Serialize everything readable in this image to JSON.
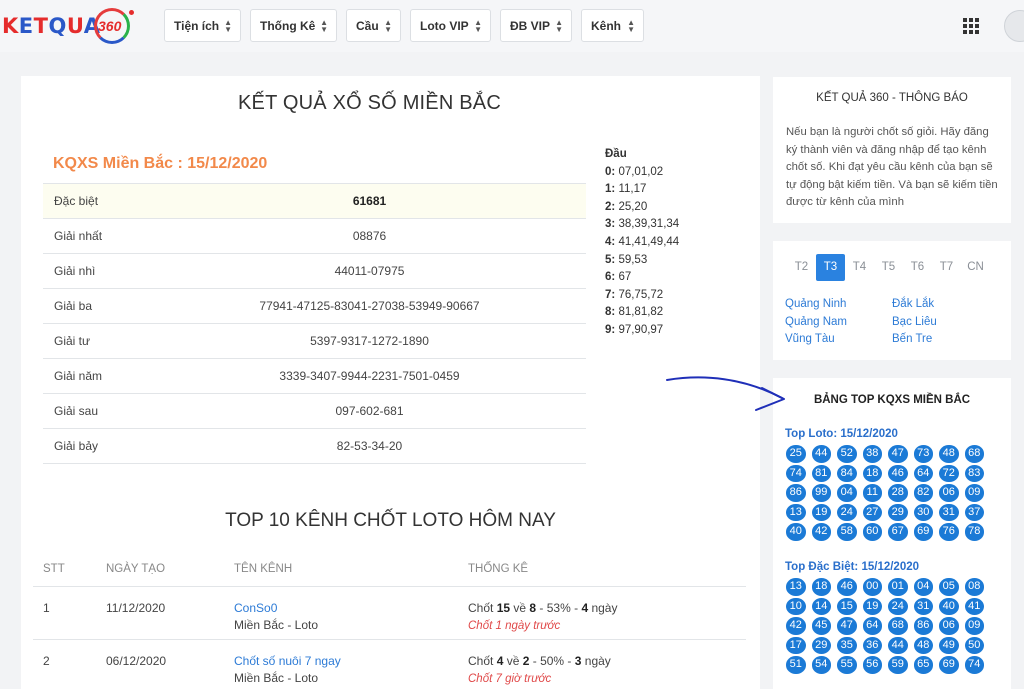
{
  "logo": {
    "text": "KETQUA",
    "suffix": "360"
  },
  "nav": [
    {
      "label": "Tiện ích"
    },
    {
      "label": "Thống Kê"
    },
    {
      "label": "Cầu"
    },
    {
      "label": "Loto VIP"
    },
    {
      "label": "ĐB VIP"
    },
    {
      "label": "Kênh"
    }
  ],
  "main": {
    "title": "KẾT QUẢ XỔ SỐ MIỀN BẮC",
    "subtitle": "KQXS Miền Bắc : 15/12/2020",
    "results": [
      {
        "label": "Đặc biệt",
        "value": "61681"
      },
      {
        "label": "Giải nhất",
        "value": "08876"
      },
      {
        "label": "Giải nhì",
        "value": "44011-07975"
      },
      {
        "label": "Giải ba",
        "value": "77941-47125-83041-27038-53949-90667"
      },
      {
        "label": "Giải tư",
        "value": "5397-9317-1272-1890"
      },
      {
        "label": "Giải năm",
        "value": "3339-3407-9944-2231-7501-0459"
      },
      {
        "label": "Giải sau",
        "value": "097-602-681"
      },
      {
        "label": "Giải bảy",
        "value": "82-53-34-20"
      }
    ],
    "dau": {
      "header": "Đầu",
      "rows": [
        {
          "k": "0:",
          "v": "07,01,02"
        },
        {
          "k": "1:",
          "v": "11,17"
        },
        {
          "k": "2:",
          "v": "25,20"
        },
        {
          "k": "3:",
          "v": "38,39,31,34"
        },
        {
          "k": "4:",
          "v": "41,41,49,44"
        },
        {
          "k": "5:",
          "v": "59,53"
        },
        {
          "k": "6:",
          "v": "67"
        },
        {
          "k": "7:",
          "v": "76,75,72"
        },
        {
          "k": "8:",
          "v": "81,81,82"
        },
        {
          "k": "9:",
          "v": "97,90,97"
        }
      ]
    },
    "top10_title": "TOP 10 KÊNH CHỐT LOTO HÔM NAY",
    "channel_headers": [
      "STT",
      "NGÀY TẠO",
      "TÊN KÊNH",
      "THỐNG KÊ"
    ],
    "channels": [
      {
        "stt": "1",
        "date": "11/12/2020",
        "name": "ConSo0",
        "region": "Miền Bắc - Loto",
        "stat_pre": "Chốt ",
        "stat_a": "15",
        "stat_mid1": " về ",
        "stat_b": "8",
        "stat_mid2": " - 53% - ",
        "stat_c": "4",
        "stat_post": " ngày",
        "ago": "Chốt 1 ngày trước"
      },
      {
        "stt": "2",
        "date": "06/12/2020",
        "name": "Chốt số nuôi 7 ngay",
        "region": "Miền Bắc - Loto",
        "stat_pre": "Chốt ",
        "stat_a": "4",
        "stat_mid1": " về ",
        "stat_b": "2",
        "stat_mid2": " - 50% - ",
        "stat_c": "3",
        "stat_post": " ngày",
        "ago": "Chốt 7 giờ trước"
      }
    ]
  },
  "notice": {
    "title": "KẾT QUẢ 360 - THÔNG BÁO",
    "body": "Nếu bạn là người chốt số giỏi. Hãy đăng ký thành viên và đăng nhập để tạo kênh chốt số. Khi đạt yêu cầu kênh của bạn sẽ tự động bật kiếm tiền. Và bạn sẽ kiếm tiền được từ kênh của mình"
  },
  "days": {
    "tabs": [
      "T2",
      "T3",
      "T4",
      "T5",
      "T6",
      "T7",
      "CN"
    ],
    "active": "T3",
    "provinces_left": [
      "Quảng Ninh",
      "Quảng Nam",
      "Vũng Tàu"
    ],
    "provinces_right": [
      "Đắk Lắk",
      "Bạc Liêu",
      "Bến Tre"
    ]
  },
  "tops": {
    "title": "BẢNG TOP KQXS MIỀN BẮC",
    "loto_label": "Top Loto: 15/12/2020",
    "loto": [
      "25",
      "44",
      "52",
      "38",
      "47",
      "73",
      "48",
      "68",
      "74",
      "81",
      "84",
      "18",
      "46",
      "64",
      "72",
      "83",
      "86",
      "99",
      "04",
      "11",
      "28",
      "82",
      "06",
      "09",
      "13",
      "19",
      "24",
      "27",
      "29",
      "30",
      "31",
      "37",
      "40",
      "42",
      "58",
      "60",
      "67",
      "69",
      "76",
      "78"
    ],
    "db_label": "Top Đặc Biệt: 15/12/2020",
    "db": [
      "13",
      "18",
      "46",
      "00",
      "01",
      "04",
      "05",
      "08",
      "10",
      "14",
      "15",
      "19",
      "24",
      "31",
      "40",
      "41",
      "42",
      "45",
      "47",
      "64",
      "68",
      "86",
      "06",
      "09",
      "17",
      "29",
      "35",
      "36",
      "44",
      "48",
      "49",
      "50",
      "51",
      "54",
      "55",
      "56",
      "59",
      "65",
      "69",
      "74"
    ]
  },
  "colors": {
    "accent": "#2a82e0",
    "ball": "#1b7ad6",
    "orange": "#f2894a",
    "red": "#e04a4a"
  }
}
